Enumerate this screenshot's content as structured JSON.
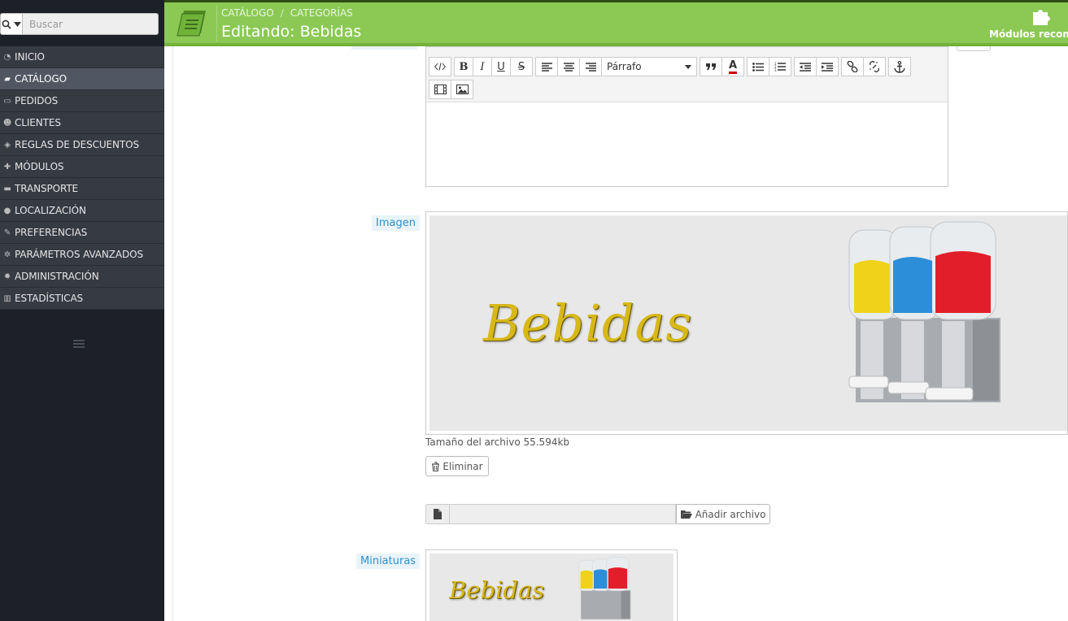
{
  "sidebar": {
    "search_placeholder": "Buscar",
    "menu": [
      {
        "label": "INICIO",
        "icon": "dashboard-icon",
        "active": false
      },
      {
        "label": "CATÁLOGO",
        "icon": "book-icon",
        "active": true
      },
      {
        "label": "PEDIDOS",
        "icon": "credit-card-icon",
        "active": false
      },
      {
        "label": "CLIENTES",
        "icon": "users-icon",
        "active": false
      },
      {
        "label": "REGLAS DE DESCUENTOS",
        "icon": "tag-icon",
        "active": false
      },
      {
        "label": "MÓDULOS",
        "icon": "puzzle-icon",
        "active": false
      },
      {
        "label": "TRANSPORTE",
        "icon": "truck-icon",
        "active": false
      },
      {
        "label": "LOCALIZACIÓN",
        "icon": "globe-icon",
        "active": false
      },
      {
        "label": "PREFERENCIAS",
        "icon": "wrench-icon",
        "active": false
      },
      {
        "label": "PARÁMETROS AVANZADOS",
        "icon": "cogs-icon",
        "active": false
      },
      {
        "label": "ADMINISTRACIÓN",
        "icon": "gear-icon",
        "active": false
      },
      {
        "label": "ESTADÍSTICAS",
        "icon": "bar-chart-icon",
        "active": false
      }
    ]
  },
  "header": {
    "breadcrumb_1": "CATÁLOGO",
    "breadcrumb_sep": "/",
    "breadcrumb_2": "CATEGORÍAS",
    "title": "Editando: Bebidas",
    "modules_label": "Módulos recomendados"
  },
  "editor": {
    "format_value": "Párrafo"
  },
  "image": {
    "label": "Imagen",
    "banner_text": "Bebidas",
    "file_size": "Tamaño del archivo 55.594kb",
    "delete_label": "Eliminar",
    "add_file_label": "Añadir archivo"
  },
  "thumbnails": {
    "label": "Miniaturas",
    "banner_text": "Bebidas"
  },
  "colors": {
    "header_green": "#8bc954",
    "sidebar_bg": "#1d2027",
    "menu_bg": "#363a41",
    "active_item": "#505762",
    "label_blue": "#2f8fc9"
  }
}
